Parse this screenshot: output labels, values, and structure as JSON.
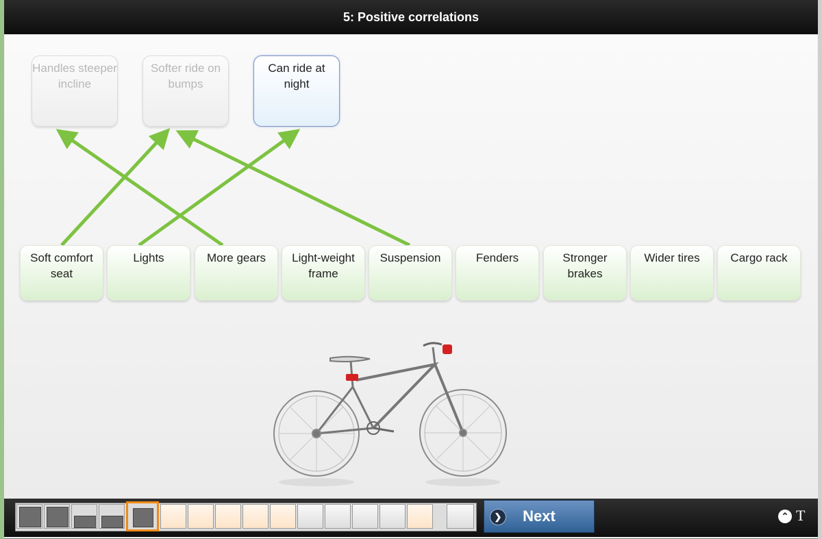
{
  "header": {
    "title": "5: Positive correlations"
  },
  "targets": [
    {
      "label": "Handles steeper incline",
      "state": "faded"
    },
    {
      "label": "Softer ride on bumps",
      "state": "faded"
    },
    {
      "label": "Can ride at night",
      "state": "active"
    }
  ],
  "options": [
    {
      "label": "Soft comfort seat"
    },
    {
      "label": "Lights"
    },
    {
      "label": "More gears"
    },
    {
      "label": "Light-weight frame"
    },
    {
      "label": "Suspension"
    },
    {
      "label": "Fenders"
    },
    {
      "label": "Stronger brakes"
    },
    {
      "label": "Wider tires"
    },
    {
      "label": "Cargo rack"
    }
  ],
  "connections": [
    {
      "from": "Soft comfort seat",
      "to": "Softer ride on bumps"
    },
    {
      "from": "Lights",
      "to": "Can ride at night"
    },
    {
      "from": "More gears",
      "to": "Handles steeper incline"
    },
    {
      "from": "Suspension",
      "to": "Softer ride on bumps"
    }
  ],
  "colors": {
    "arrow": "#7dc241",
    "accent_current": "#f08a16",
    "next_button": "#3b6ea5"
  },
  "footer": {
    "next_label": "Next",
    "text_toggle": "T",
    "slides": [
      "done",
      "done",
      "done",
      "done",
      "current",
      "peach",
      "peach",
      "peach",
      "peach",
      "peach",
      "gray",
      "gray",
      "gray",
      "gray",
      "peach",
      "gray"
    ]
  },
  "icons": {
    "next": "chevron-right-icon",
    "scroll_up": "chevron-up-icon",
    "text": "text-toggle-icon"
  }
}
